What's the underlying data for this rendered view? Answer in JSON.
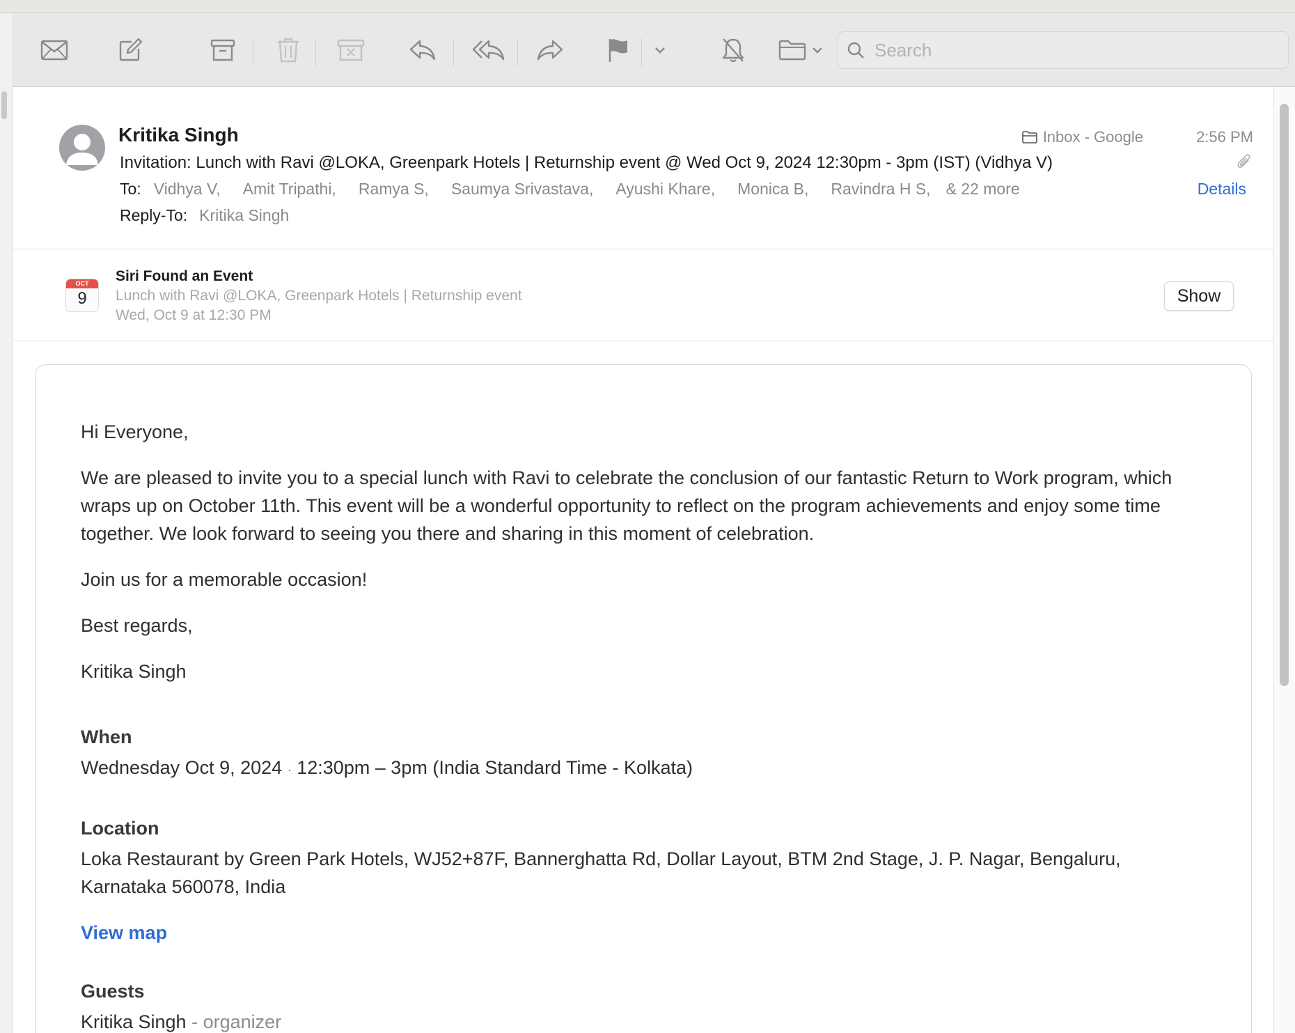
{
  "toolbar": {
    "buttons": [
      {
        "name": "get-mail",
        "icon": "envelope-icon"
      },
      {
        "name": "compose",
        "icon": "compose-icon"
      },
      {
        "name": "archive",
        "icon": "archive-box-icon"
      },
      {
        "name": "delete",
        "icon": "trash-icon"
      },
      {
        "name": "junk",
        "icon": "junk-box-icon"
      },
      {
        "name": "reply",
        "icon": "reply-arrow-icon"
      },
      {
        "name": "reply-all",
        "icon": "reply-all-arrow-icon"
      },
      {
        "name": "forward",
        "icon": "forward-arrow-icon"
      },
      {
        "name": "flag",
        "icon": "flag-icon"
      },
      {
        "name": "mute",
        "icon": "bell-slash-icon"
      },
      {
        "name": "move",
        "icon": "folder-icon"
      }
    ],
    "search_placeholder": "Search"
  },
  "message": {
    "sender": "Kritika Singh",
    "mailbox": "Inbox - Google",
    "time": "2:56 PM",
    "subject": "Invitation: Lunch with Ravi @LOKA, Greenpark Hotels | Returnship event @ Wed Oct 9, 2024 12:30pm - 3pm (IST) (Vidhya V)",
    "to_label": "To:",
    "recipients": [
      "Vidhya V,",
      "Amit Tripathi,",
      "Ramya S,",
      "Saumya Srivastava,",
      "Ayushi Khare,",
      "Monica B,",
      "Ravindra H S,"
    ],
    "more": "& 22 more",
    "details_label": "Details",
    "reply_to_label": "Reply-To:",
    "reply_to": "Kritika Singh"
  },
  "siri": {
    "title": "Siri Found an Event",
    "event": "Lunch with Ravi @LOKA, Greenpark Hotels | Returnship event",
    "when": "Wed, Oct 9 at 12:30 PM",
    "show_label": "Show",
    "calendar_month": "OCT",
    "calendar_day": "9"
  },
  "body": {
    "greeting": "Hi Everyone,",
    "paragraph": "We are pleased to invite you to a special lunch with Ravi to celebrate the conclusion of our fantastic Return to Work program, which wraps up on October 11th. This event will be a wonderful opportunity to reflect on the program achievements and enjoy some time together. We look forward to seeing you there and sharing in this moment of celebration.",
    "join": "Join us for a memorable occasion!",
    "regards": "Best regards,",
    "signature": "Kritika Singh",
    "when_heading": "When",
    "when_date": "Wednesday Oct 9, 2024",
    "when_sep": "·",
    "when_time": "12:30pm – 3pm (India Standard Time - Kolkata)",
    "location_heading": "Location",
    "location": "Loka Restaurant by Green Park Hotels, WJ52+87F, Bannerghatta Rd, Dollar Layout, BTM 2nd Stage, J. P. Nagar, Bengaluru, Karnataka 560078, India",
    "view_map": "View map",
    "guests_heading": "Guests",
    "guest_name": "Kritika Singh",
    "guest_role": "- organizer"
  },
  "colors": {
    "accent_blue": "#2d6fd6",
    "calendar_red": "#e1534a"
  }
}
